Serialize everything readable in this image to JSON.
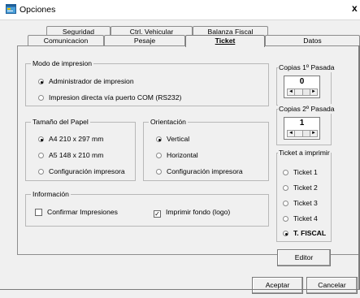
{
  "window": {
    "title": "Opciones"
  },
  "tabs_back": [
    "Seguridad",
    "Ctrl. Vehicular",
    "Balanza Fiscal"
  ],
  "tabs_front": [
    "Comunicacion",
    "Pesaje",
    "Ticket",
    "Datos"
  ],
  "active_tab": "Ticket",
  "modo": {
    "title": "Modo de impresion",
    "options": [
      "Administrador de impresion",
      "Impresion directa vía puerto COM (RS232)"
    ],
    "selected": 0
  },
  "papel": {
    "title": "Tamaño del Papel",
    "options": [
      "A4 210 x 297 mm",
      "A5 148 x 210 mm",
      "Configuración impresora"
    ],
    "selected": 0
  },
  "orientacion": {
    "title": "Orientación",
    "options": [
      "Vertical",
      "Horizontal",
      "Configuración impresora"
    ],
    "selected": 0
  },
  "informacion": {
    "title": "Información",
    "confirmar": {
      "label": "Confirmar Impresiones",
      "checked": false
    },
    "fondo": {
      "label": "Imprimir fondo (logo)",
      "checked": true
    }
  },
  "copias1": {
    "title": "Copias 1º Pasada",
    "value": "0"
  },
  "copias2": {
    "title": "Copias 2º Pasada",
    "value": "1"
  },
  "ticket_imprimir": {
    "title": "Ticket a imprimir",
    "options": [
      "Ticket 1",
      "Ticket 2",
      "Ticket 3",
      "Ticket 4",
      "T. FISCAL"
    ],
    "selected": 4
  },
  "buttons": {
    "editor": "Editor",
    "aceptar": "Aceptar",
    "cancelar": "Cancelar"
  }
}
